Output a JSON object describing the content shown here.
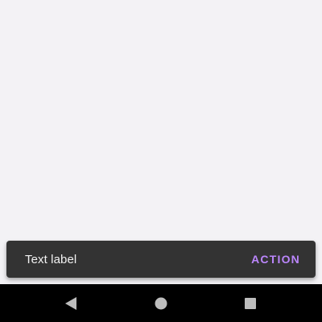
{
  "snackbar": {
    "text": "Text label",
    "action_label": "ACTION",
    "action_color": "#bb86fc",
    "background_color": "#333333"
  },
  "navbar": {
    "buttons": [
      {
        "icon": "back-triangle-icon"
      },
      {
        "icon": "home-circle-icon"
      },
      {
        "icon": "recents-square-icon"
      }
    ],
    "icon_color": "#bdbdbd"
  },
  "screen": {
    "background_color": "#f3f2f5"
  }
}
